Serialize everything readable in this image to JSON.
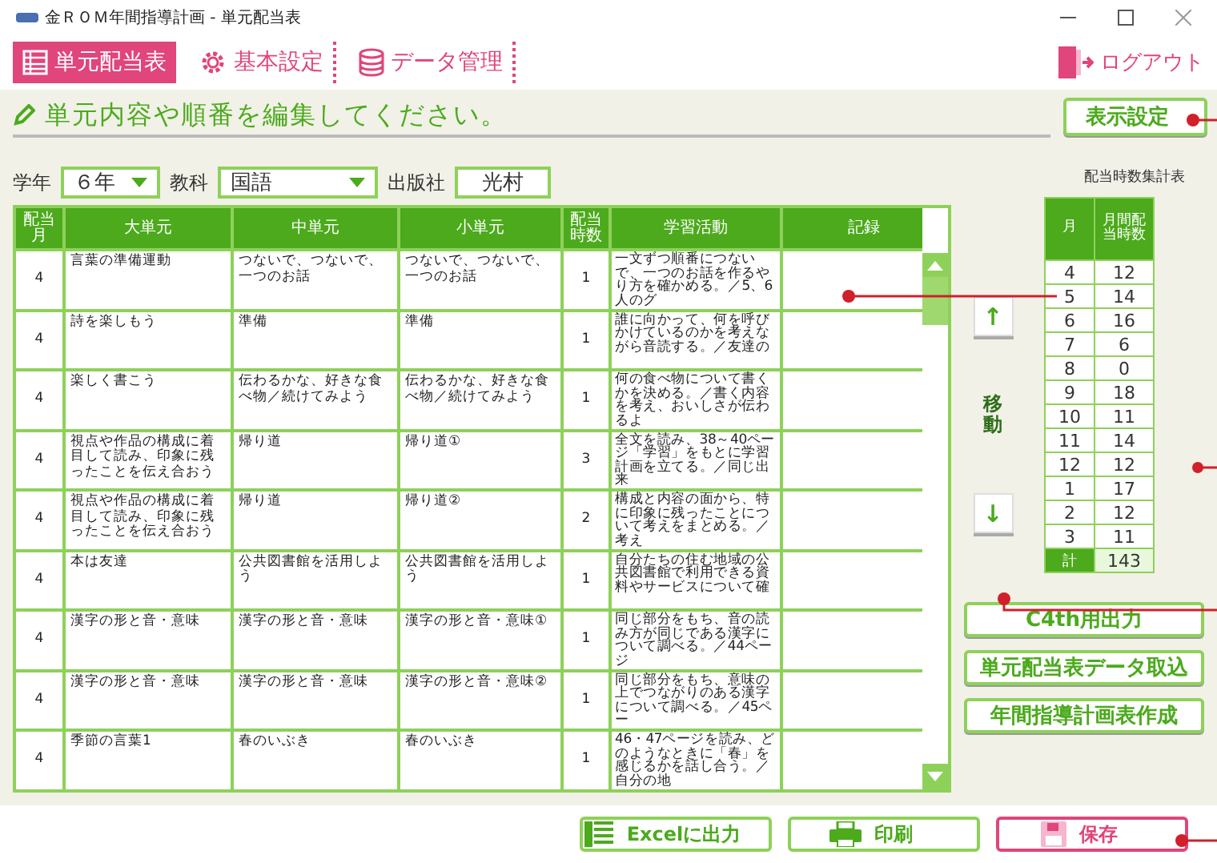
{
  "window": {
    "title": "金ＲＯＭ年間指導計画 - 単元配当表"
  },
  "nav": [
    {
      "label": "単元配当表",
      "selected": true
    },
    {
      "label": "基本設定",
      "selected": false
    },
    {
      "label": "データ管理",
      "selected": false
    }
  ],
  "logout": "ログアウト",
  "instruction": "単元内容や順番を編集してください。",
  "display_settings": "表示設定",
  "filters": [
    {
      "label": "学年",
      "value": "６年",
      "kind": "select"
    },
    {
      "label": "教科",
      "value": "国語",
      "kind": "select"
    },
    {
      "label": "出版社",
      "value": "光村",
      "kind": "text"
    }
  ],
  "table": {
    "columns": [
      "配当月",
      "大単元",
      "中単元",
      "小単元",
      "配当時数",
      "学習活動",
      "記録"
    ],
    "rows": [
      {
        "month": "4",
        "large": "言葉の準備運動",
        "middle": "つないで、つないで、一つのお話",
        "small": "つないで、つないで、一つのお話",
        "hours": "1",
        "activity": "一文ずつ順番につないで、一つのお話を作るやり方を確かめる。／5、6人のグ"
      },
      {
        "month": "4",
        "large": "詩を楽しもう",
        "middle": "準備",
        "small": "準備",
        "hours": "1",
        "activity": "誰に向かって、何を呼びかけているのかを考えながら音読する。／友達の"
      },
      {
        "month": "4",
        "large": "楽しく書こう",
        "middle": "伝わるかな、好きな食べ物／続けてみよう",
        "small": "伝わるかな、好きな食べ物／続けてみよう",
        "hours": "1",
        "activity": "何の食べ物について書くかを決める。／書く内容を考え、おいしさが伝わるよ"
      },
      {
        "month": "4",
        "large": "視点や作品の構成に着目して読み、印象に残ったことを伝え合おう",
        "middle": "帰り道",
        "small": "帰り道①",
        "hours": "3",
        "activity": "全文を読み、38～40ページ「学習」をもとに学習計画を立てる。／同じ出来"
      },
      {
        "month": "4",
        "large": "視点や作品の構成に着目して読み、印象に残ったことを伝え合おう",
        "middle": "帰り道",
        "small": "帰り道②",
        "hours": "2",
        "activity": "構成と内容の面から、特に印象に残ったことについて考えをまとめる。／考え"
      },
      {
        "month": "4",
        "large": "本は友達",
        "middle": "公共図書館を活用しよう",
        "small": "公共図書館を活用しよう",
        "hours": "1",
        "activity": "自分たちの住む地域の公共図書館で利用できる資料やサービスについて確"
      },
      {
        "month": "4",
        "large": "漢字の形と音・意味",
        "middle": "漢字の形と音・意味",
        "small": "漢字の形と音・意味①",
        "hours": "1",
        "activity": "同じ部分をもち、音の読み方が同じである漢字について調べる。／44ページ"
      },
      {
        "month": "4",
        "large": "漢字の形と音・意味",
        "middle": "漢字の形と音・意味",
        "small": "漢字の形と音・意味②",
        "hours": "1",
        "activity": "同じ部分をもち、意味の上でつながりのある漢字について調べる。／45ペー"
      },
      {
        "month": "4",
        "large": "季節の言葉1",
        "middle": "春のいぶき",
        "small": "春のいぶき",
        "hours": "1",
        "activity": "46・47ページを読み、どのようなときに「春」を感じるかを話し合う。／自分の地"
      }
    ]
  },
  "move": {
    "up": "↑",
    "label": "移動",
    "down": "↓"
  },
  "summary": {
    "title": "配当時数集計表",
    "columns": [
      "月",
      "月間配当時数"
    ],
    "rows": [
      [
        "4",
        "12"
      ],
      [
        "5",
        "14"
      ],
      [
        "6",
        "16"
      ],
      [
        "7",
        "6"
      ],
      [
        "8",
        "0"
      ],
      [
        "9",
        "18"
      ],
      [
        "10",
        "11"
      ],
      [
        "11",
        "14"
      ],
      [
        "12",
        "12"
      ],
      [
        "1",
        "17"
      ],
      [
        "2",
        "12"
      ],
      [
        "3",
        "11"
      ]
    ],
    "total": [
      "計",
      "143"
    ]
  },
  "side_buttons": [
    "C4th用出力",
    "単元配当表データ取込",
    "年間指導計画表作成"
  ],
  "bottom_buttons": [
    {
      "label": "Excelに出力",
      "kind": "excel"
    },
    {
      "label": "印刷",
      "kind": "print"
    },
    {
      "label": "保存",
      "kind": "save"
    }
  ]
}
